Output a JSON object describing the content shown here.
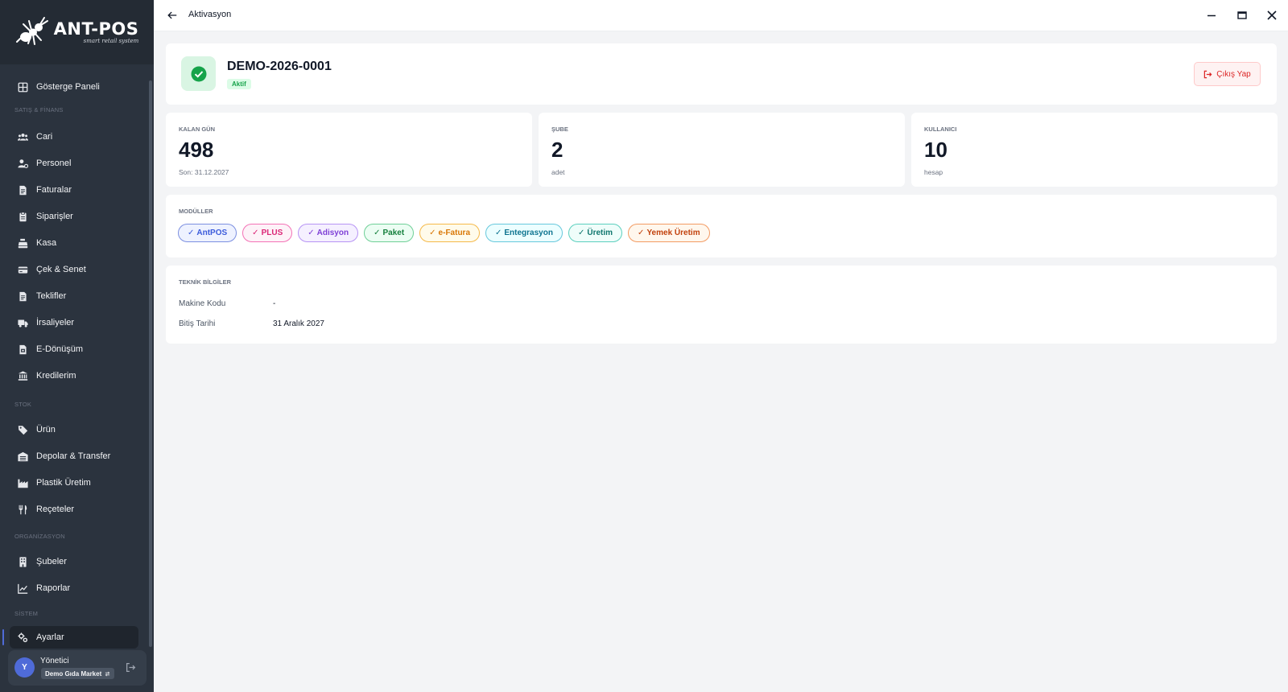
{
  "brand": {
    "name": "ANT-POS",
    "tagline": "smart retail system"
  },
  "sidebar": {
    "items": [
      {
        "id": "dashboard",
        "label": "Gösterge Paneli",
        "icon": "grid-icon"
      },
      {
        "id": "cari",
        "label": "Cari",
        "icon": "users-icon"
      },
      {
        "id": "personel",
        "label": "Personel",
        "icon": "user-cog-icon"
      },
      {
        "id": "faturalar",
        "label": "Faturalar",
        "icon": "document-icon"
      },
      {
        "id": "siparisler",
        "label": "Siparişler",
        "icon": "clipboard-icon"
      },
      {
        "id": "kasa",
        "label": "Kasa",
        "icon": "cash-register-icon"
      },
      {
        "id": "cek-senet",
        "label": "Çek & Senet",
        "icon": "card-icon"
      },
      {
        "id": "teklifler",
        "label": "Teklifler",
        "icon": "document-icon"
      },
      {
        "id": "irsaliyeler",
        "label": "İrsaliyeler",
        "icon": "truck-icon"
      },
      {
        "id": "e-donusum",
        "label": "E-Dönüşüm",
        "icon": "file-digital-icon"
      },
      {
        "id": "kredilerim",
        "label": "Kredilerim",
        "icon": "bank-icon"
      },
      {
        "id": "urun",
        "label": "Ürün",
        "icon": "tag-icon"
      },
      {
        "id": "depolar",
        "label": "Depolar & Transfer",
        "icon": "warehouse-icon"
      },
      {
        "id": "plastik-uretim",
        "label": "Plastik Üretim",
        "icon": "factory-icon"
      },
      {
        "id": "receteler",
        "label": "Reçeteler",
        "icon": "utensils-icon"
      },
      {
        "id": "subeler",
        "label": "Şubeler",
        "icon": "building-icon"
      },
      {
        "id": "raporlar",
        "label": "Raporlar",
        "icon": "chart-line-icon"
      },
      {
        "id": "ayarlar",
        "label": "Ayarlar",
        "icon": "gears-icon",
        "active": true
      }
    ],
    "sections": {
      "satis_finans": "SATIŞ & FİNANS",
      "stok": "STOK",
      "organizasyon": "ORGANİZASYON",
      "sistem": "SİSTEM"
    },
    "user": {
      "initial": "Y",
      "name": "Yönetici",
      "store": "Demo Gıda Market"
    }
  },
  "header": {
    "title": "Aktivasyon"
  },
  "license": {
    "code": "DEMO-2026-0001",
    "status": "Aktif",
    "logout_label": "Çıkış Yap",
    "status_color": "#16a34a",
    "logout_color": "#dc2626"
  },
  "stats": [
    {
      "label": "KALAN GÜN",
      "value": "498",
      "sub": "Son: 31.12.2027"
    },
    {
      "label": "ŞUBE",
      "value": "2",
      "sub": "adet"
    },
    {
      "label": "KULLANICI",
      "value": "10",
      "sub": "hesap"
    }
  ],
  "modules": {
    "title": "MODÜLLER",
    "items": [
      {
        "label": "AntPOS",
        "color": "#3b5bdb",
        "bg": "#eef2ff",
        "border": "#7c8fe0"
      },
      {
        "label": "PLUS",
        "color": "#db2777",
        "bg": "#fdf2f8",
        "border": "#f472b6"
      },
      {
        "label": "Adisyon",
        "color": "#7e3fd6",
        "bg": "#f5f0ff",
        "border": "#b794f4"
      },
      {
        "label": "Paket",
        "color": "#15803d",
        "bg": "#ecfdf3",
        "border": "#6fcf97"
      },
      {
        "label": "e-Fatura",
        "color": "#d97706",
        "bg": "#fffbeb",
        "border": "#f5b94a"
      },
      {
        "label": "Entegrasyon",
        "color": "#0e7490",
        "bg": "#ecfeff",
        "border": "#67c8dc"
      },
      {
        "label": "Üretim",
        "color": "#0f766e",
        "bg": "#effdfa",
        "border": "#5ccfbe"
      },
      {
        "label": "Yemek Üretim",
        "color": "#c2410c",
        "bg": "#fff7ed",
        "border": "#f39b63"
      }
    ]
  },
  "technical": {
    "title": "TEKNİK BİLGİLER",
    "rows": [
      {
        "key": "Makine Kodu",
        "value": "-"
      },
      {
        "key": "Bitiş Tarihi",
        "value": "31 Aralık 2027"
      }
    ]
  }
}
